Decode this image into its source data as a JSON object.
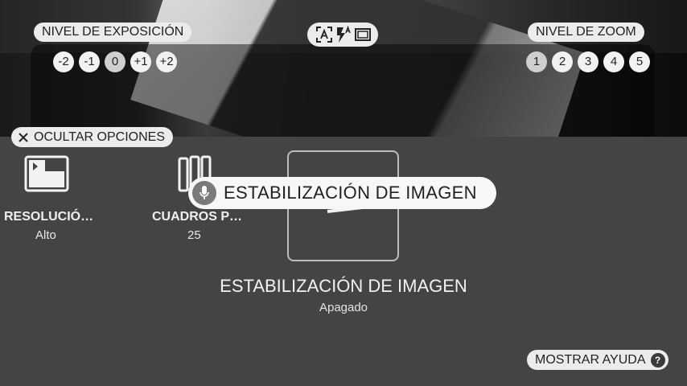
{
  "exposure": {
    "label": "NIVEL DE EXPOSICIÓN",
    "levels": [
      "-2",
      "-1",
      "0",
      "+1",
      "+2"
    ],
    "selected": "0"
  },
  "zoom": {
    "label": "NIVEL DE ZOOM",
    "levels": [
      "1",
      "2",
      "3",
      "4",
      "5"
    ],
    "selected": "1"
  },
  "quick_icons": [
    "auto-focus-icon",
    "flash-auto-icon",
    "aspect-ratio-icon"
  ],
  "hide_options": {
    "label": "OCULTAR OPCIONES",
    "icon": "close-icon"
  },
  "options": [
    {
      "icon": "resolution-icon",
      "label": "RESOLUCIÓ…",
      "value": "Alto"
    },
    {
      "icon": "frames-icon",
      "label": "CUADROS P…",
      "value": "25"
    }
  ],
  "stabilization": {
    "toast": "ESTABILIZACIÓN DE IMAGEN",
    "title": "ESTABILIZACIÓN DE IMAGEN",
    "value": "Apagado"
  },
  "help": {
    "label": "MOSTRAR AYUDA",
    "icon": "help-icon",
    "glyph": "?"
  }
}
